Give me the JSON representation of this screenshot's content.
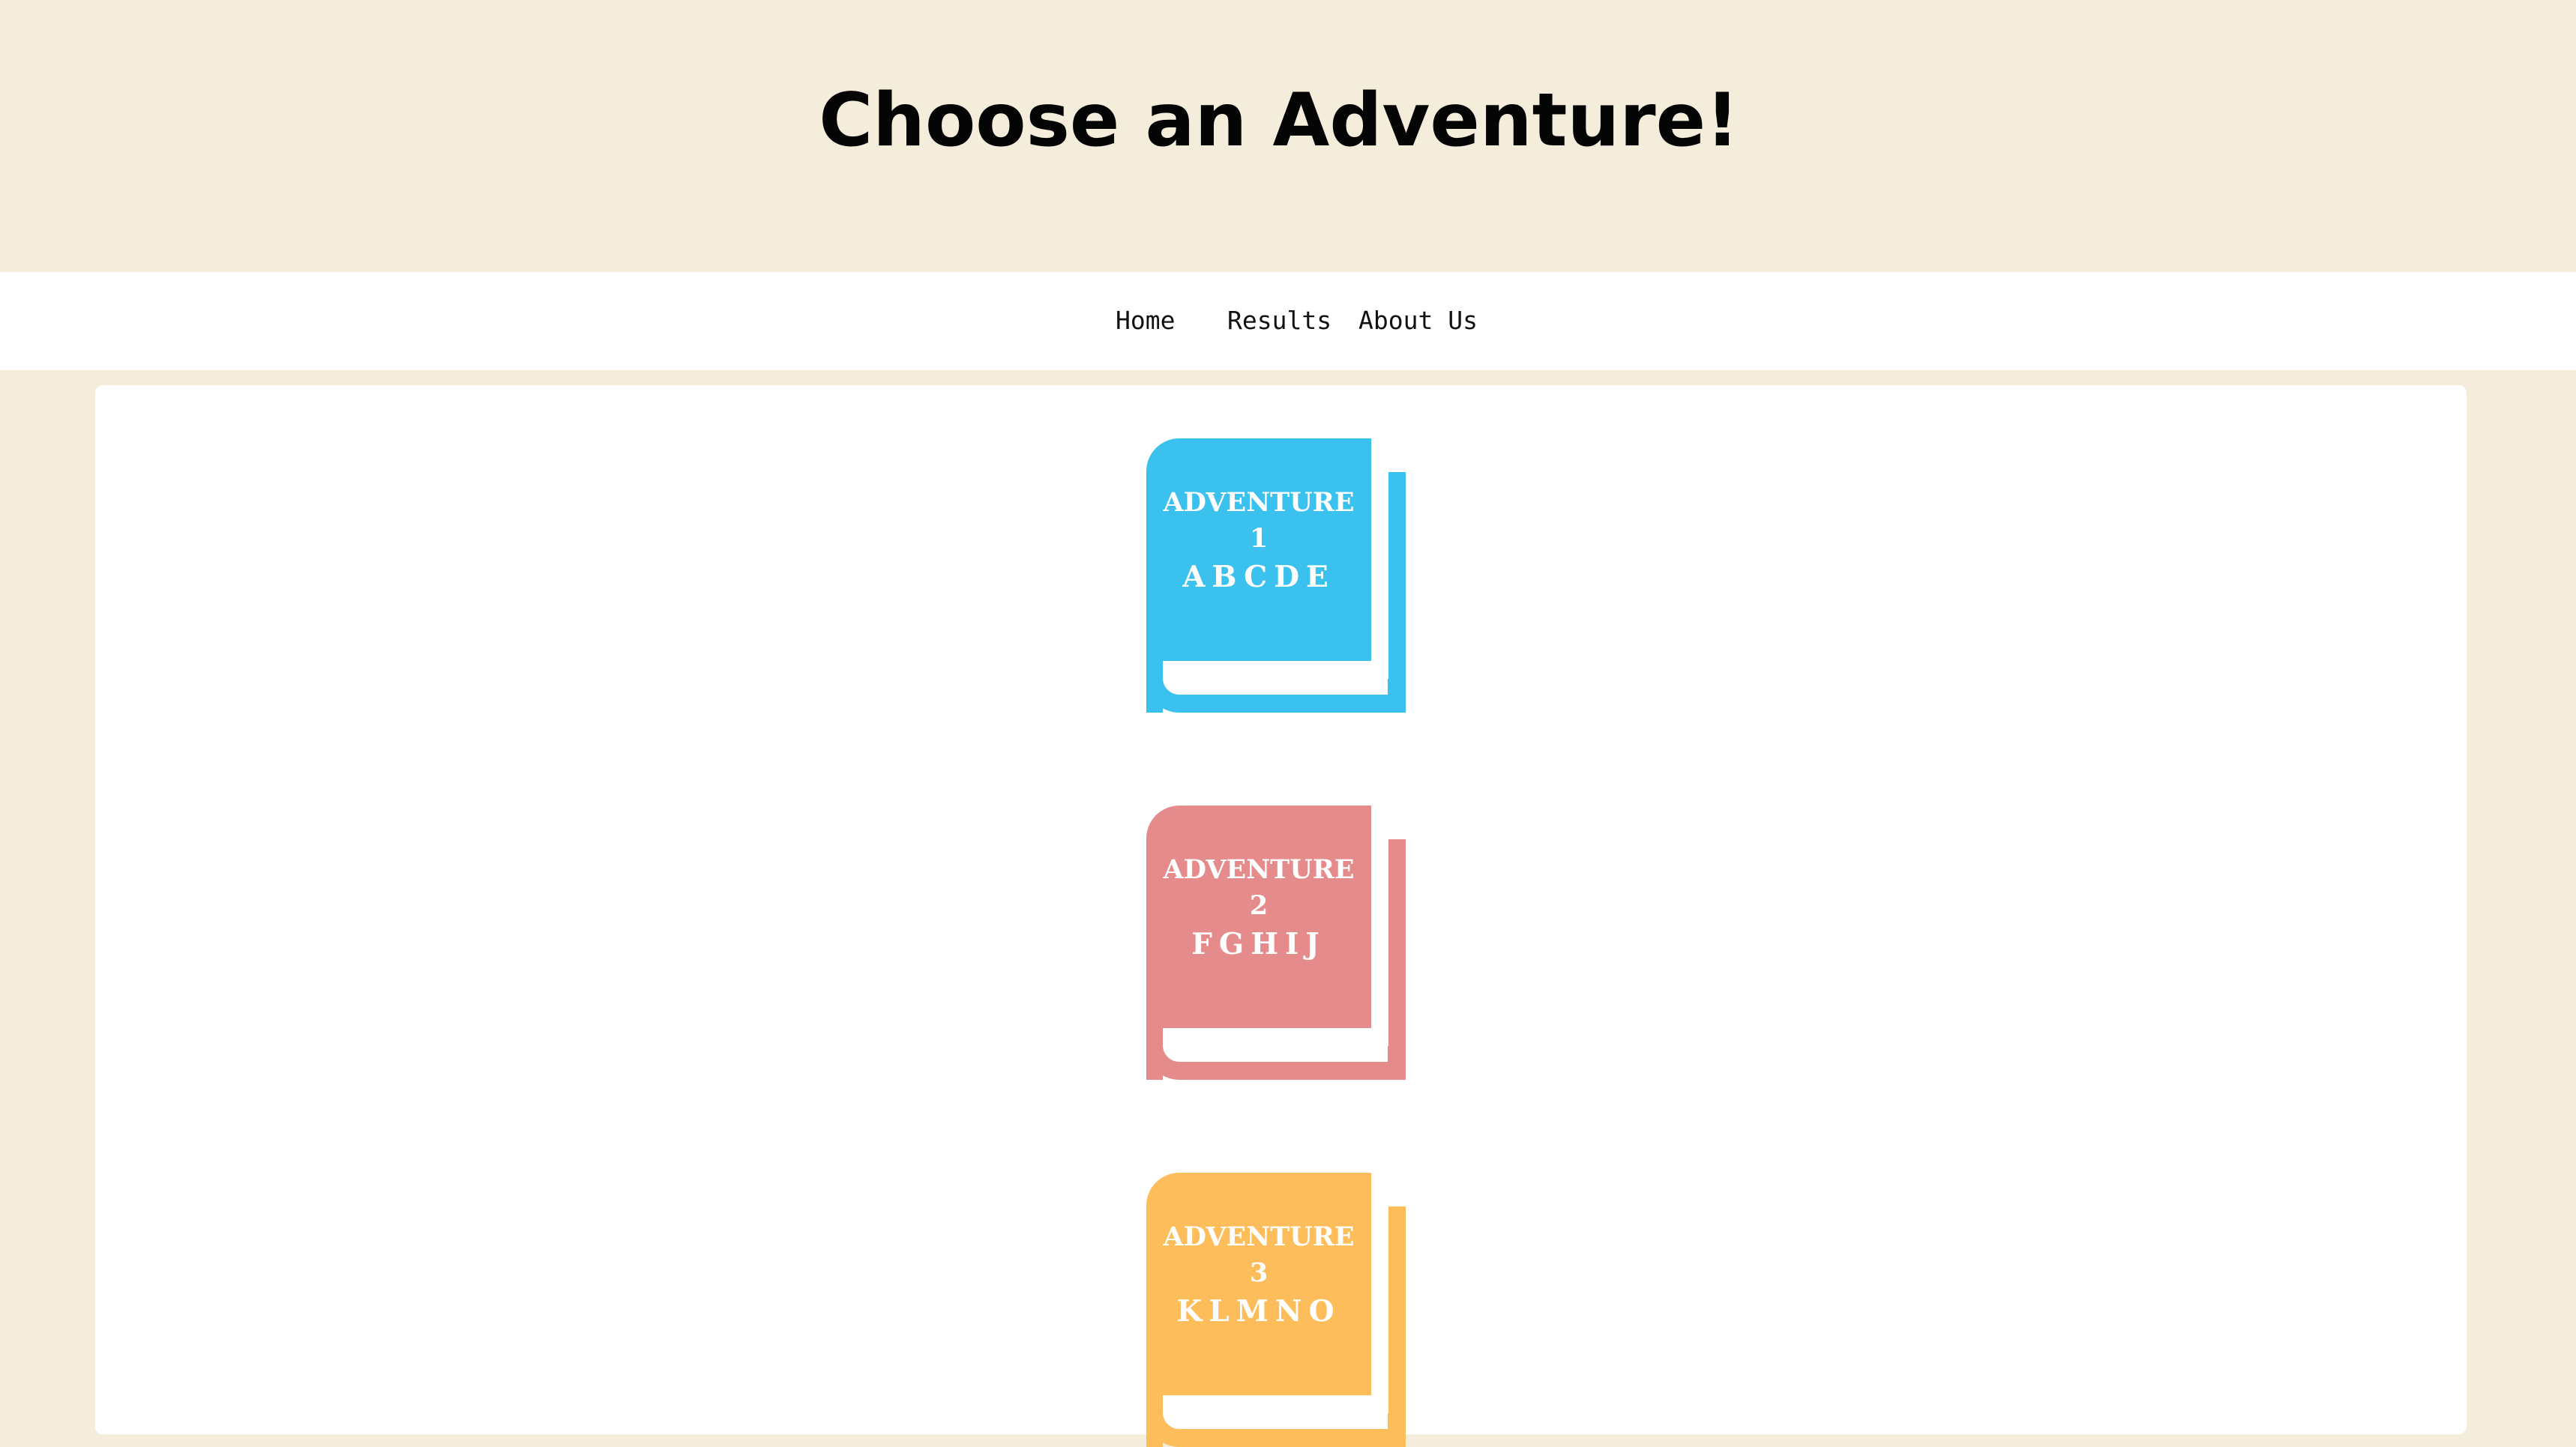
{
  "header": {
    "title": "Choose an Adventure!"
  },
  "nav": {
    "items": [
      {
        "label": "Home"
      },
      {
        "label": "Results"
      },
      {
        "label": "About Us"
      }
    ]
  },
  "adventures": [
    {
      "title_line1": "ADVENTURE",
      "title_line2": "1",
      "letters": "ABCDE",
      "color": "#3bc1ee"
    },
    {
      "title_line1": "ADVENTURE",
      "title_line2": "2",
      "letters": "FGHIJ",
      "color": "#e58b8b"
    },
    {
      "title_line1": "ADVENTURE",
      "title_line2": "3",
      "letters": "KLMNO",
      "color": "#fdbd5a"
    }
  ],
  "colors": {
    "page_background": "#f5eddb",
    "nav_background": "#ffffff",
    "panel_background": "#ffffff",
    "title_text": "#050505"
  }
}
